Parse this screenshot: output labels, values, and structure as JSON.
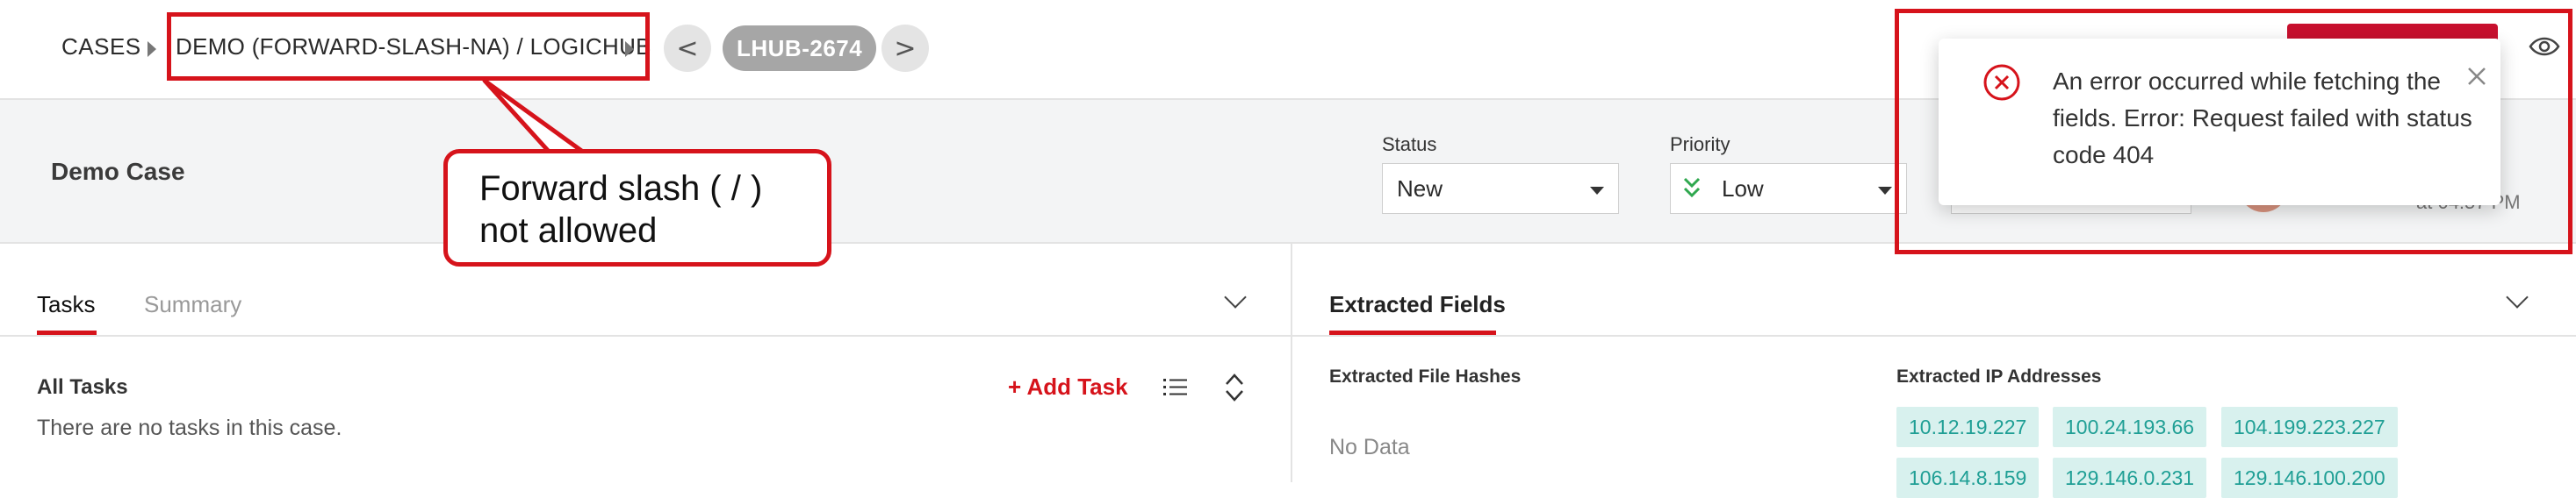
{
  "breadcrumb": {
    "root": "CASES",
    "case_name": "DEMO (FORWARD-SLASH-NA) / LOGICHUB",
    "prev_symbol": "<",
    "next_symbol": ">",
    "case_id": "LHUB-2674"
  },
  "header": {
    "case_title": "Demo Case",
    "status_label": "Status",
    "status_value": "New",
    "priority_label": "Priority",
    "priority_value": "Low",
    "partial_time": "at 04:57 PM"
  },
  "callout": {
    "text_line1": "Forward slash ( / )",
    "text_line2": "not allowed"
  },
  "notification": {
    "type": "error",
    "message": "An error occurred while fetching the fields. Error: Request failed with status code 404"
  },
  "left_panel": {
    "tabs": [
      "Tasks",
      "Summary"
    ],
    "active_tab": "Tasks",
    "section_title": "All Tasks",
    "empty_message": "There are no tasks in this case.",
    "add_task_label": "+ Add Task"
  },
  "right_panel": {
    "tab": "Extracted Fields",
    "file_hashes_title": "Extracted File Hashes",
    "file_hashes_empty": "No Data",
    "ip_title": "Extracted IP Addresses",
    "ip_addresses": [
      "10.12.19.227",
      "100.24.193.66",
      "104.199.223.227",
      "106.14.8.159",
      "129.146.0.231",
      "129.146.100.200"
    ]
  },
  "colors": {
    "accent_red": "#d6131b",
    "chip_bg": "#d8f1ee",
    "chip_text": "#1f9f95"
  }
}
